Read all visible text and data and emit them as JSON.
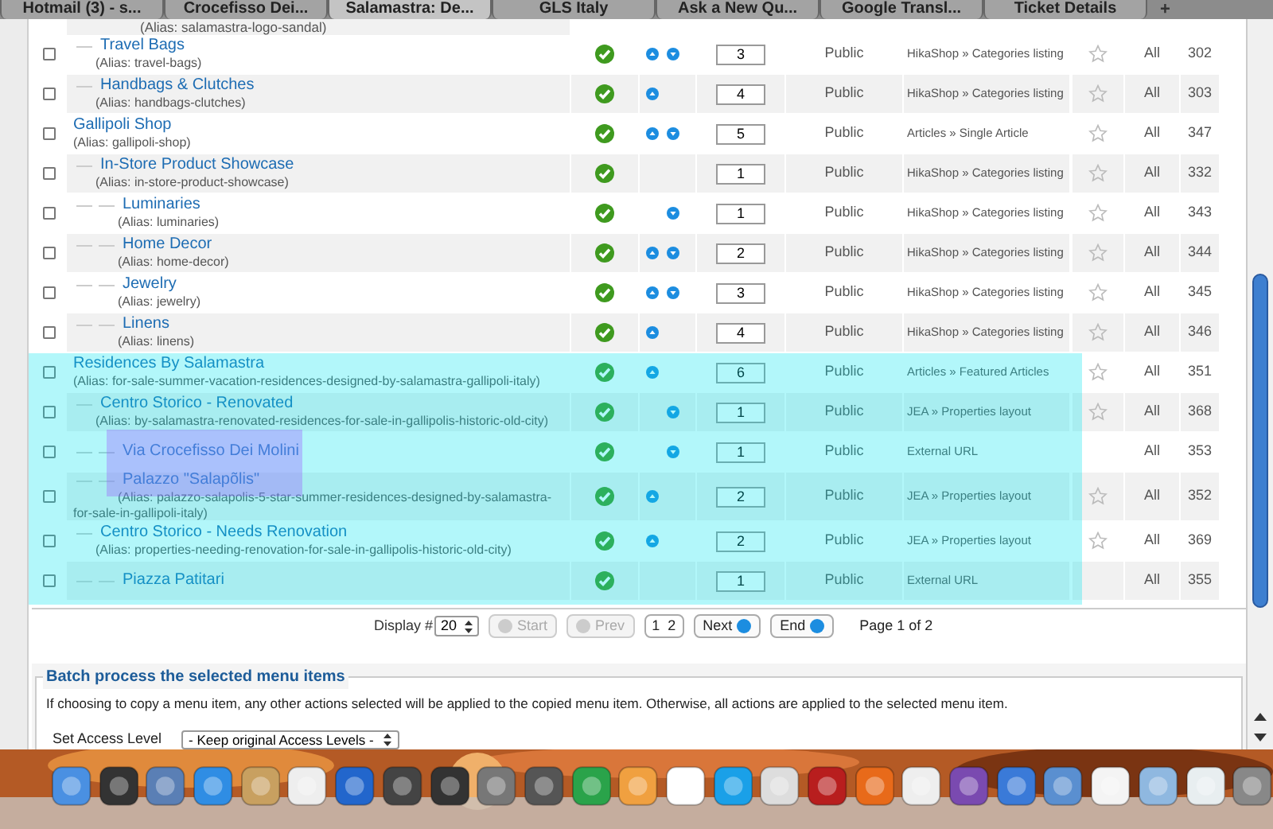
{
  "browser_tabs": [
    {
      "label": "Hotmail (3) - s...",
      "selected": false
    },
    {
      "label": "Crocefisso Dei...",
      "selected": false
    },
    {
      "label": "Salamastra: De...",
      "selected": true
    },
    {
      "label": "GLS Italy",
      "selected": false
    },
    {
      "label": "Ask a New Qu...",
      "selected": false
    },
    {
      "label": "Google Transl...",
      "selected": false
    },
    {
      "label": "Ticket Details",
      "selected": false
    }
  ],
  "add_tab": "+",
  "menu_items": {
    "continued_alias": "(Alias: salamastra-logo-sandal)",
    "continued": [
      {
        "checked": false,
        "title": "Travel Bags",
        "alias": "(Alias: travel-bags)",
        "published": true,
        "order_up": true,
        "order_down": true,
        "order": "3",
        "access": "Public",
        "menu_type": "HikaShop » Categories listing",
        "home_star": true,
        "language": "All",
        "id": "302"
      },
      {
        "checked": false,
        "title": "Handbags & Clutches",
        "alias": "(Alias: handbags-clutches)",
        "published": true,
        "order_up": true,
        "order_down": false,
        "order": "4",
        "access": "Public",
        "menu_type": "HikaShop » Categories listing",
        "home_star": true,
        "language": "All",
        "id": "303"
      }
    ],
    "items": [
      {
        "checked": false,
        "title": "Gallipoli Shop",
        "alias": "(Alias: gallipoli-shop)",
        "published": true,
        "order_up": true,
        "order_down": true,
        "order": "5",
        "access": "Public",
        "menu_type": "Articles » Single Article",
        "home_star": true,
        "language": "All",
        "id": "347",
        "children": [
          {
            "checked": false,
            "title": "In-Store Product Showcase",
            "alias": "(Alias: in-store-product-showcase)",
            "published": true,
            "order_up": false,
            "order_down": false,
            "order": "1",
            "access": "Public",
            "menu_type": "HikaShop » Categories listing",
            "home_star": true,
            "language": "All",
            "id": "332",
            "children": [
              {
                "checked": false,
                "title": "Luminaries",
                "alias": "(Alias: luminaries)",
                "published": true,
                "order_up": false,
                "order_down": true,
                "order": "1",
                "access": "Public",
                "menu_type": "HikaShop » Categories listing",
                "home_star": true,
                "language": "All",
                "id": "343"
              },
              {
                "checked": false,
                "title": "Home Decor",
                "alias": "(Alias: home-decor)",
                "published": true,
                "order_up": true,
                "order_down": true,
                "order": "2",
                "access": "Public",
                "menu_type": "HikaShop » Categories listing",
                "home_star": true,
                "language": "All",
                "id": "344"
              },
              {
                "checked": false,
                "title": "Jewelry",
                "alias": "(Alias: jewelry)",
                "published": true,
                "order_up": true,
                "order_down": true,
                "order": "3",
                "access": "Public",
                "menu_type": "HikaShop » Categories listing",
                "home_star": true,
                "language": "All",
                "id": "345"
              },
              {
                "checked": false,
                "title": "Linens",
                "alias": "(Alias: linens)",
                "published": true,
                "order_up": true,
                "order_down": false,
                "order": "4",
                "access": "Public",
                "menu_type": "HikaShop » Categories listing",
                "home_star": true,
                "language": "All",
                "id": "346"
              }
            ]
          }
        ]
      },
      {
        "checked": false,
        "title": "Residences By Salamastra",
        "alias": "(Alias: for-sale-summer-vacation-residences-designed-by-salamastra-gallipoli-italy)",
        "published": true,
        "order_up": true,
        "order_down": false,
        "order": "6",
        "access": "Public",
        "menu_type": "Articles » Featured Articles",
        "home_star": true,
        "language": "All",
        "id": "351",
        "children": [
          {
            "checked": false,
            "title": "Centro Storico - Renovated",
            "alias": "(Alias: by-salamastra-renovated-residences-for-sale-in-gallipolis-historic-old-city)",
            "published": true,
            "order_up": false,
            "order_down": true,
            "order": "1",
            "access": "Public",
            "menu_type": "JEA » Properties layout",
            "home_star": true,
            "language": "All",
            "id": "368",
            "children": [
              {
                "checked": false,
                "title": "Via Crocefisso Dei Molini",
                "published": true,
                "order_up": false,
                "order_down": true,
                "order": "1",
                "access": "Public",
                "menu_type": "External URL",
                "home_star": false,
                "language": "All",
                "id": "353"
              },
              {
                "checked": false,
                "title": "Palazzo \"Salapõlis\"",
                "alias": "(Alias: palazzo-salapolis-5-star-summer-residences-designed-by-salamastra-for-sale-in-gallipoli-italy)",
                "published": true,
                "order_up": true,
                "order_down": false,
                "order": "2",
                "access": "Public",
                "menu_type": "JEA » Properties layout",
                "home_star": true,
                "language": "All",
                "id": "352"
              }
            ]
          },
          {
            "checked": false,
            "title": "Centro Storico - Needs Renovation",
            "alias": "(Alias: properties-needing-renovation-for-sale-in-gallipolis-historic-old-city)",
            "published": true,
            "order_up": true,
            "order_down": false,
            "order": "2",
            "access": "Public",
            "menu_type": "JEA » Properties layout",
            "home_star": true,
            "language": "All",
            "id": "369",
            "children": [
              {
                "checked": false,
                "title": "Piazza Patitari",
                "published": true,
                "order_up": false,
                "order_down": false,
                "order": "1",
                "access": "Public",
                "menu_type": "External URL",
                "home_star": false,
                "language": "All",
                "id": "355"
              }
            ]
          }
        ]
      }
    ]
  },
  "pagination": {
    "display_label": "Display #",
    "display_value": "20",
    "nav_before": [
      {
        "label": "Start",
        "disabled": true
      },
      {
        "label": "Prev",
        "disabled": true
      }
    ],
    "pages": [
      "1",
      "2"
    ],
    "nav_after": [
      {
        "label": "Next",
        "disabled": false
      },
      {
        "label": "End",
        "disabled": false
      }
    ],
    "page_info": "Page 1 of 2"
  },
  "batch": {
    "legend": "Batch process the selected menu items",
    "description": "If choosing to copy a menu item, any other actions selected will be applied to the copied menu item. Otherwise, all actions are applied to the selected menu item.",
    "access_label": "Set Access Level",
    "access_value": "- Keep original Access Levels -"
  }
}
